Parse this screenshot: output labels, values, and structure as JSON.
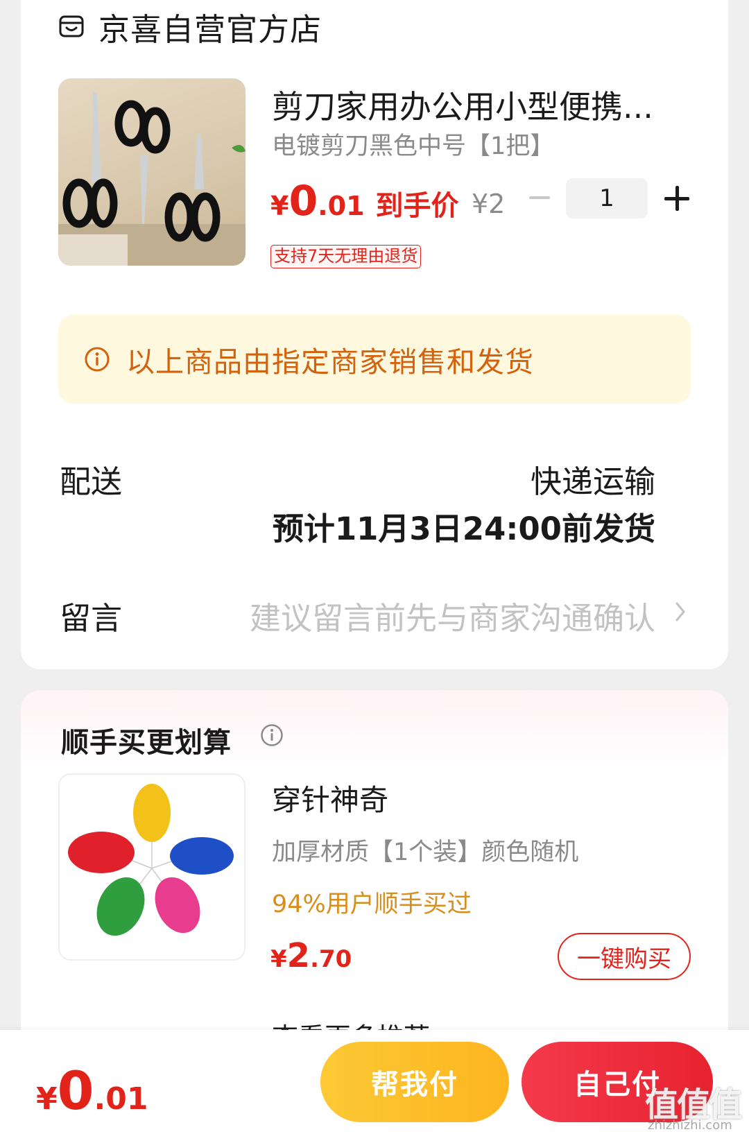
{
  "store": {
    "name": "京喜自营官方店",
    "icon": "store-icon"
  },
  "product": {
    "title": "剪刀家用办公用小型便携...",
    "spec": "电镀剪刀黑色中号【1把】",
    "price_currency": "¥",
    "price_int": "0",
    "price_dec": ".01",
    "price_tag": "到手价",
    "original_price": "¥2",
    "quantity": "1",
    "return_badge": "支持7天无理由退货"
  },
  "notice": {
    "text": "以上商品由指定商家销售和发货",
    "icon": "info-icon"
  },
  "delivery": {
    "label": "配送",
    "method": "快递运输",
    "time": "预计11月3日24:00前发货"
  },
  "message": {
    "label": "留言",
    "placeholder": "建议留言前先与商家沟通确认"
  },
  "recommend": {
    "title": "顺手买更划算",
    "name": "穿针神奇",
    "spec": "加厚材质【1个装】颜色随机",
    "bought": "94%用户顺手买过",
    "price_currency": "¥",
    "price_int": "2",
    "price_dec": ".70",
    "buy_label": "一键购买",
    "more": "查看更多推荐"
  },
  "footer": {
    "price_currency": "¥",
    "price_int": "0",
    "price_dec": ".01",
    "help_pay": "帮我付",
    "self_pay": "自己付"
  },
  "watermark": {
    "text": "值值值",
    "site": "zhizhizhi.com"
  },
  "colors": {
    "accent": "#e2231a",
    "notice_bg": "#fef8df",
    "notice_text": "#d4620c",
    "bought_text": "#d98e1b",
    "help_pay": "#fdbf2a",
    "self_pay": "#ee2d3b"
  }
}
